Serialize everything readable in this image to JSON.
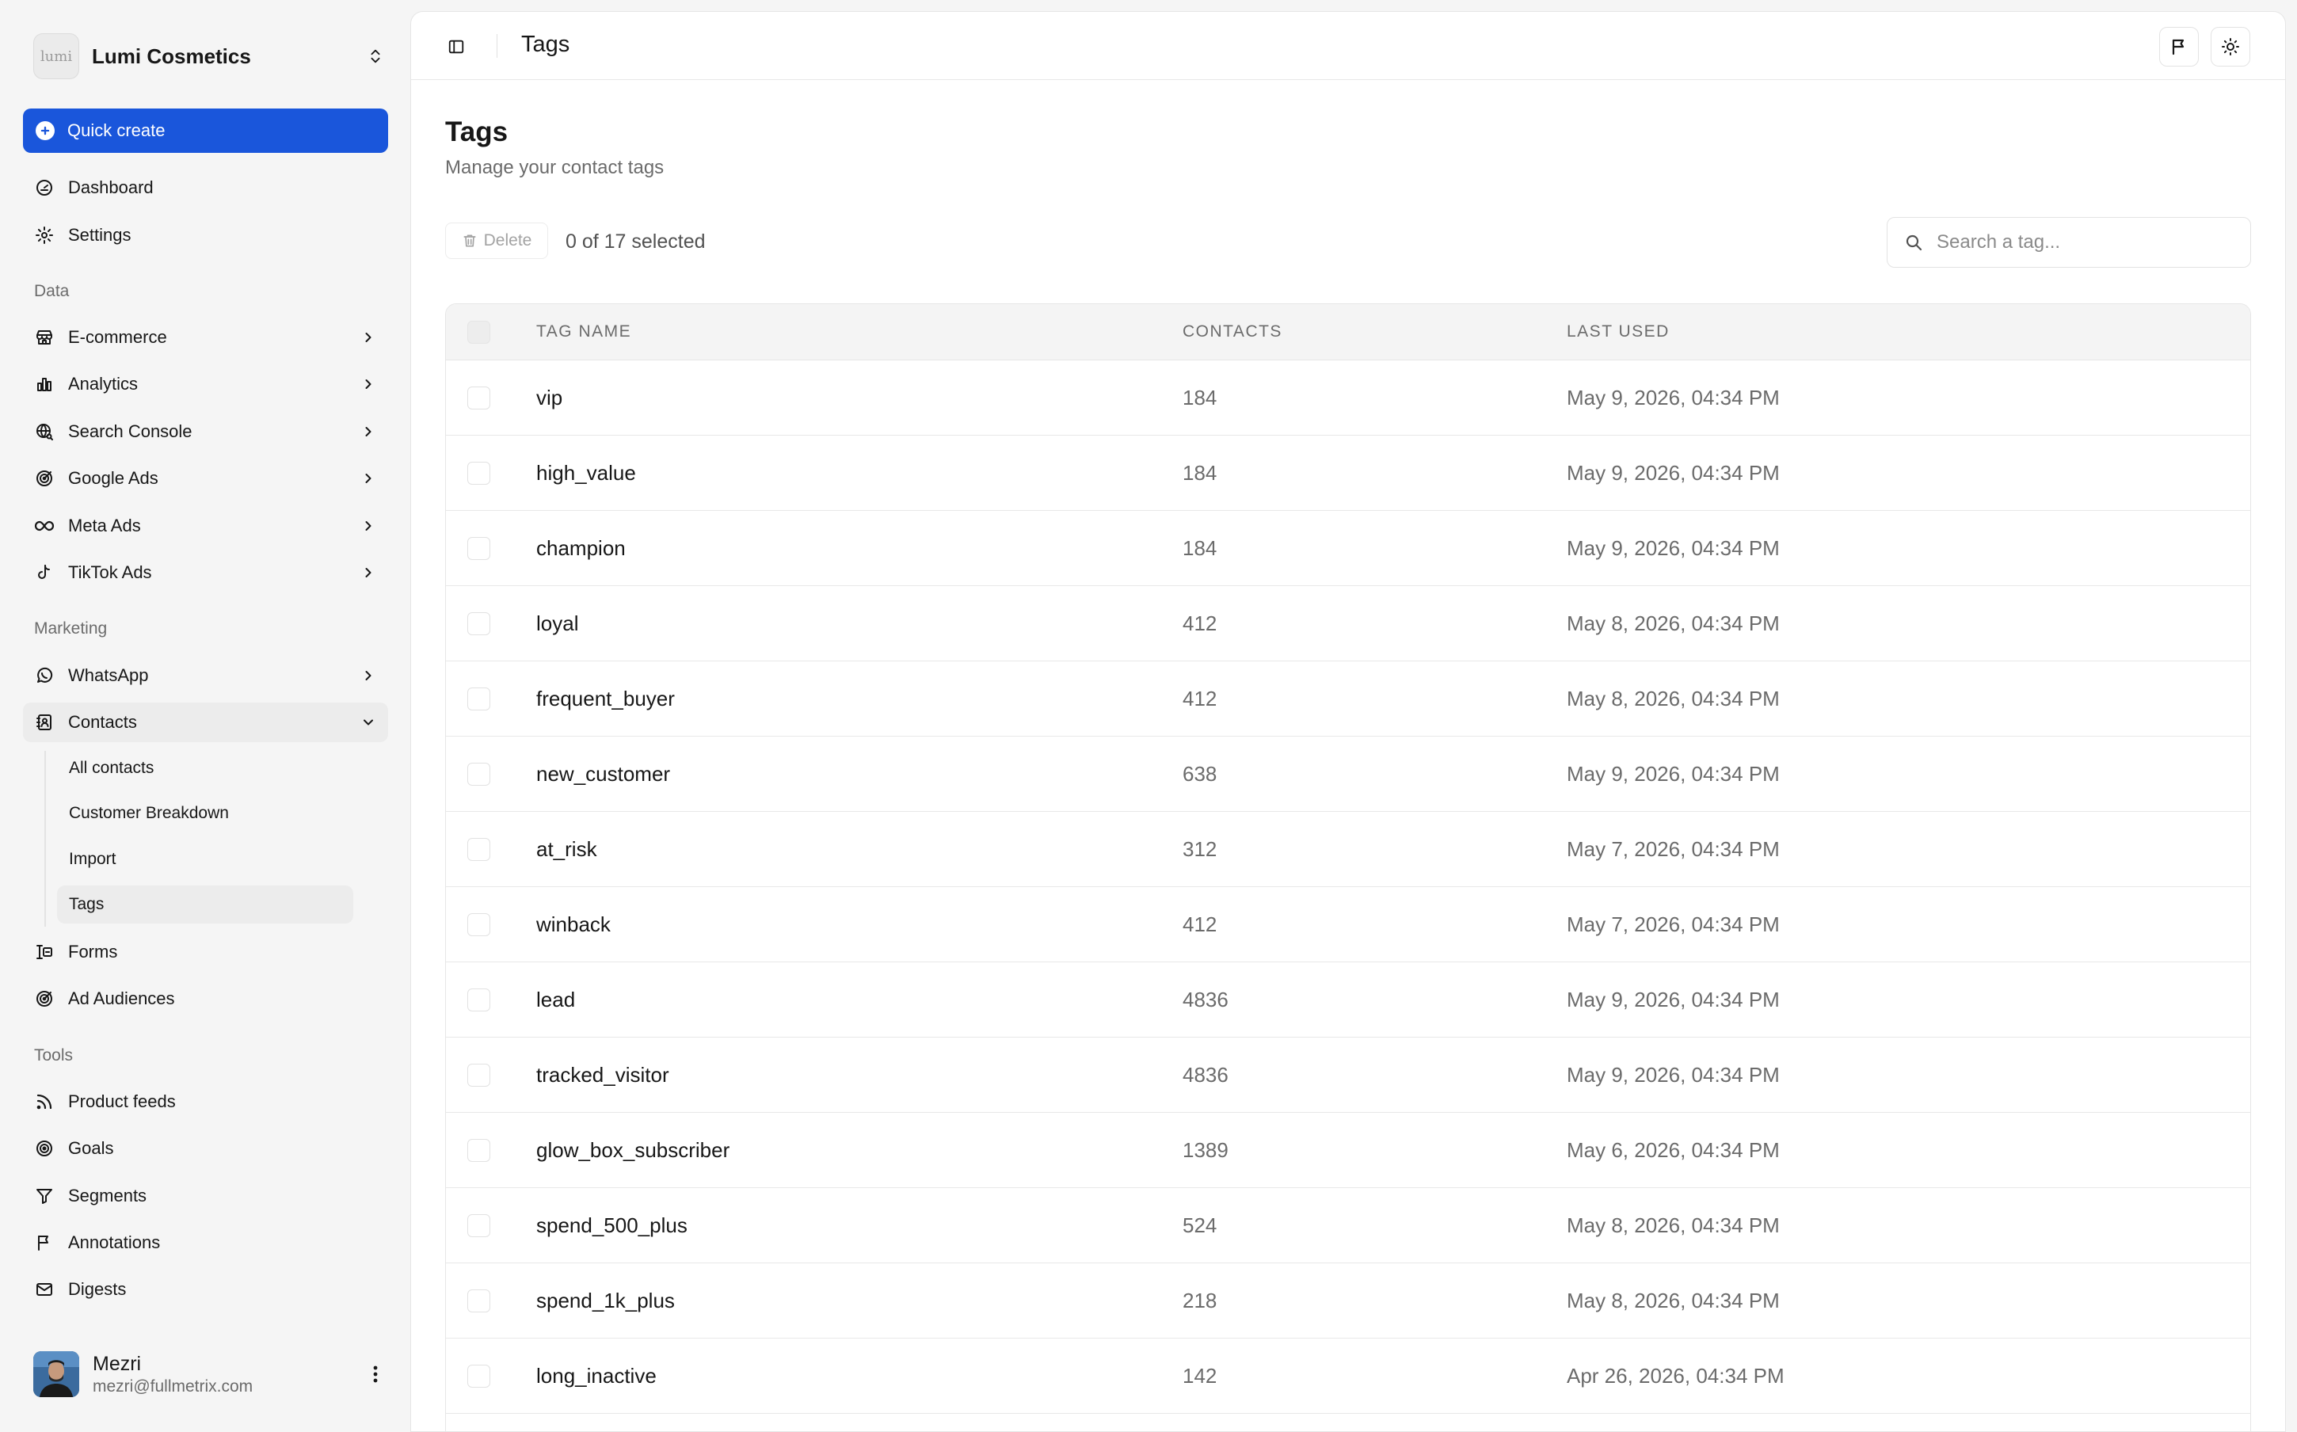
{
  "org": {
    "name": "Lumi Cosmetics",
    "logo_text": "lumi"
  },
  "quick_create_label": "Quick create",
  "nav_top": [
    {
      "label": "Dashboard",
      "icon": "gauge-icon"
    },
    {
      "label": "Settings",
      "icon": "gear-icon"
    }
  ],
  "sections": {
    "data": "Data",
    "marketing": "Marketing",
    "tools": "Tools"
  },
  "data_items": [
    {
      "label": "E-commerce",
      "icon": "store-icon"
    },
    {
      "label": "Analytics",
      "icon": "bar-chart-icon"
    },
    {
      "label": "Search Console",
      "icon": "globe-search-icon"
    },
    {
      "label": "Google Ads",
      "icon": "target-icon"
    },
    {
      "label": "Meta Ads",
      "icon": "infinity-icon"
    },
    {
      "label": "TikTok Ads",
      "icon": "music-note-icon"
    }
  ],
  "marketing_items": [
    {
      "label": "WhatsApp",
      "icon": "chat-bubble-icon"
    },
    {
      "label": "Contacts",
      "icon": "contact-book-icon"
    }
  ],
  "contacts_sub": [
    "All contacts",
    "Customer Breakdown",
    "Import",
    "Tags"
  ],
  "marketing_more": [
    {
      "label": "Forms",
      "icon": "form-icon"
    },
    {
      "label": "Ad Audiences",
      "icon": "target-icon"
    }
  ],
  "tools_items": [
    {
      "label": "Product feeds",
      "icon": "rss-icon"
    },
    {
      "label": "Goals",
      "icon": "goal-icon"
    },
    {
      "label": "Segments",
      "icon": "funnel-icon"
    },
    {
      "label": "Annotations",
      "icon": "flag-icon"
    },
    {
      "label": "Digests",
      "icon": "mail-icon"
    }
  ],
  "user": {
    "name": "Mezri",
    "email": "mezri@fullmetrix.com"
  },
  "topbar": {
    "title": "Tags"
  },
  "page": {
    "title": "Tags",
    "subtitle": "Manage your contact tags",
    "delete_label": "Delete",
    "selection": "0 of 17 selected",
    "search_placeholder": "Search a tag..."
  },
  "table": {
    "columns": [
      "TAG NAME",
      "CONTACTS",
      "LAST USED"
    ],
    "rows": [
      {
        "name": "vip",
        "contacts": "184",
        "last_used": "May 9, 2026, 04:34 PM"
      },
      {
        "name": "high_value",
        "contacts": "184",
        "last_used": "May 9, 2026, 04:34 PM"
      },
      {
        "name": "champion",
        "contacts": "184",
        "last_used": "May 9, 2026, 04:34 PM"
      },
      {
        "name": "loyal",
        "contacts": "412",
        "last_used": "May 8, 2026, 04:34 PM"
      },
      {
        "name": "frequent_buyer",
        "contacts": "412",
        "last_used": "May 8, 2026, 04:34 PM"
      },
      {
        "name": "new_customer",
        "contacts": "638",
        "last_used": "May 9, 2026, 04:34 PM"
      },
      {
        "name": "at_risk",
        "contacts": "312",
        "last_used": "May 7, 2026, 04:34 PM"
      },
      {
        "name": "winback",
        "contacts": "412",
        "last_used": "May 7, 2026, 04:34 PM"
      },
      {
        "name": "lead",
        "contacts": "4836",
        "last_used": "May 9, 2026, 04:34 PM"
      },
      {
        "name": "tracked_visitor",
        "contacts": "4836",
        "last_used": "May 9, 2026, 04:34 PM"
      },
      {
        "name": "glow_box_subscriber",
        "contacts": "1389",
        "last_used": "May 6, 2026, 04:34 PM"
      },
      {
        "name": "spend_500_plus",
        "contacts": "524",
        "last_used": "May 8, 2026, 04:34 PM"
      },
      {
        "name": "spend_1k_plus",
        "contacts": "218",
        "last_used": "May 8, 2026, 04:34 PM"
      },
      {
        "name": "long_inactive",
        "contacts": "142",
        "last_used": "Apr 26, 2026, 04:34 PM"
      }
    ]
  },
  "colors": {
    "accent": "#1a56db",
    "sidebar_bg": "#f5f5f5",
    "panel_bg": "#ffffff"
  }
}
